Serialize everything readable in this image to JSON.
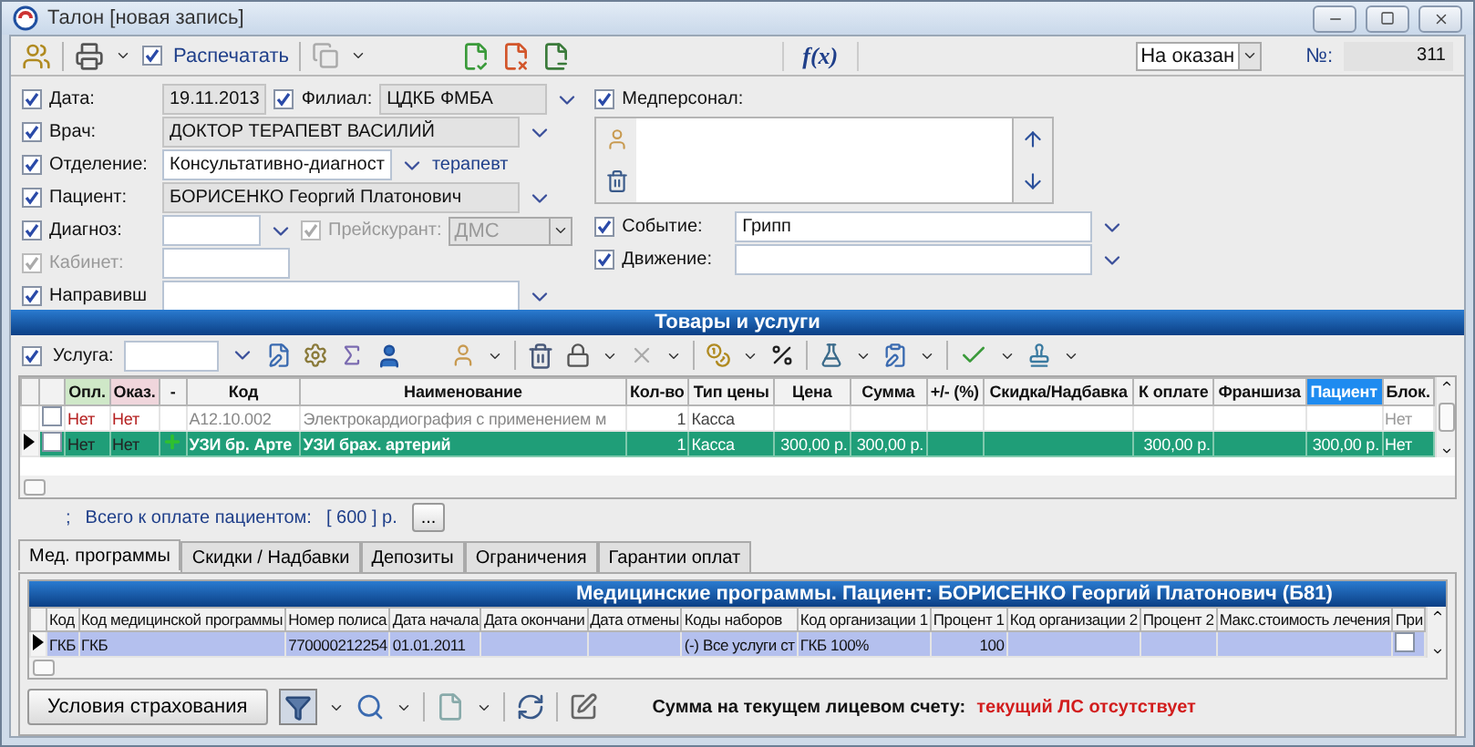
{
  "window": {
    "title": "Талон [новая запись]"
  },
  "toolbar": {
    "print": {
      "label": "Распечатать",
      "checked": true
    },
    "formula": "f(x)",
    "status": {
      "value": "На оказан"
    },
    "number": {
      "label": "№:",
      "value": "311"
    }
  },
  "form": {
    "date": {
      "label": "Дата:",
      "checked": true,
      "value": "19.11.2013",
      "readonly": true
    },
    "branch": {
      "label": "Филиал:",
      "checked": true,
      "value": "ЦДКБ ФМБА",
      "readonly": true
    },
    "doctor": {
      "label": "Врач:",
      "checked": true,
      "value": "ДОКТОР ТЕРАПЕВТ ВАСИЛИЙ",
      "readonly": true
    },
    "department": {
      "label": "Отделение:",
      "checked": true,
      "value": "Консультативно-диагност",
      "readonly": false,
      "note": "терапевт"
    },
    "patient": {
      "label": "Пациент:",
      "checked": true,
      "value": "БОРИСЕНКО Георгий Платонович",
      "readonly": true
    },
    "diagnosis": {
      "label": "Диагноз:",
      "checked": true,
      "readonly": false
    },
    "price_list": {
      "label": "Прейскурант:",
      "checked": true,
      "value": "ДМС",
      "disabled": true
    },
    "cabinet": {
      "label": "Кабинет:",
      "checked": true,
      "disabled": true,
      "readonly": false
    },
    "referrer": {
      "label": "Направивш",
      "checked": true,
      "readonly": false
    },
    "staff": {
      "label": "Медперсонал:",
      "checked": true
    },
    "event": {
      "label": "Событие:",
      "checked": true,
      "value": "Грипп",
      "readonly": false
    },
    "movement": {
      "label": "Движение:",
      "checked": true,
      "readonly": false
    }
  },
  "goods": {
    "title": "Товары и услуги",
    "service": {
      "label": "Услуга:",
      "checked": true
    },
    "columns": [
      {
        "label": "Опл.",
        "selected": false
      },
      {
        "label": "Оказ.",
        "selected": false
      },
      {
        "label": "-",
        "selected": false
      },
      {
        "label": "Код",
        "selected": false
      },
      {
        "label": "Наименование",
        "selected": false
      },
      {
        "label": "Кол-во",
        "selected": false
      },
      {
        "label": "Тип цены",
        "selected": false
      },
      {
        "label": "Цена",
        "selected": false
      },
      {
        "label": "Сумма",
        "selected": false
      },
      {
        "label": "+/- (%)",
        "selected": false
      },
      {
        "label": "Скидка/Надбавка",
        "selected": false
      },
      {
        "label": "К оплате",
        "selected": false
      },
      {
        "label": "Франшиза",
        "selected": false
      },
      {
        "label": "Пациент",
        "selected": true
      },
      {
        "label": "Блок.",
        "selected": false
      }
    ],
    "rows": [
      {
        "selected": false,
        "checked": false,
        "added": false,
        "cells": [
          "Нет",
          "Нет",
          null,
          "A12.10.002",
          "Электрокардиография с применением м",
          "1",
          "Касса",
          null,
          null,
          null,
          null,
          null,
          null,
          null,
          "Нет"
        ]
      },
      {
        "selected": true,
        "checked": false,
        "added": true,
        "cells": [
          "Нет",
          "Нет",
          null,
          "УЗИ бр. Арте",
          "УЗИ брах. артерий",
          "1",
          "Касса",
          "300,00 р.",
          "300,00 р.",
          null,
          null,
          "300,00 р.",
          null,
          "300,00 р.",
          "Нет"
        ]
      }
    ],
    "summary": {
      "separator": ";",
      "label": "Всего к оплате пациентом:",
      "value": "[ 600 ] р.",
      "button": "..."
    }
  },
  "programs": {
    "tabs": [
      {
        "label": "Мед. программы",
        "selected": true
      },
      {
        "label": "Скидки / Надбавки",
        "selected": false
      },
      {
        "label": "Депозиты",
        "selected": false
      },
      {
        "label": "Ограничения",
        "selected": false
      },
      {
        "label": "Гарантии оплат",
        "selected": false
      }
    ],
    "title": "Медицинские программы. Пациент: БОРИСЕНКО Георгий Платонович (Б81)",
    "columns": [
      "Код",
      "Код медицинской программы",
      "Номер полиса",
      "Дата начала",
      "Дата окончани",
      "Дата отмены",
      "Коды наборов",
      "Код организации 1",
      "Процент 1",
      "Код организации 2",
      "Процент 2",
      "Макс.стоимость лечения",
      "При"
    ],
    "rows": [
      {
        "selected": true,
        "flag": false,
        "cells": [
          "ГКБ",
          "ГКБ",
          "770000212254",
          "01.01.2011",
          null,
          null,
          "(-) Все услуги ст",
          "ГКБ 100%",
          "100",
          null,
          null,
          null
        ]
      }
    ]
  },
  "footer": {
    "button": "Условия страхования",
    "balance_label": "Сумма на текущем лицевом счету:",
    "balance_value": "текущий ЛС отсутствует"
  }
}
